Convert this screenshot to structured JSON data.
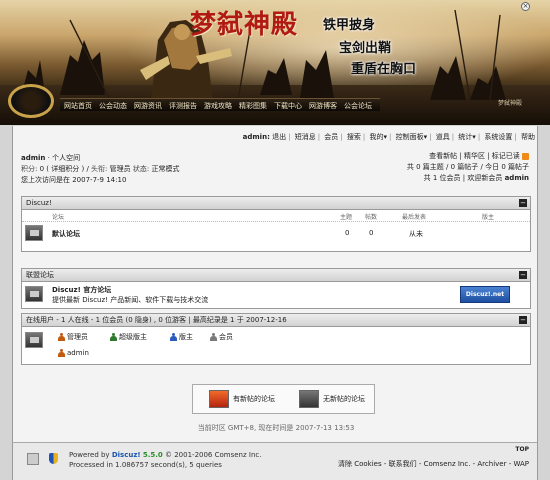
{
  "banner": {
    "title": "梦弑神殿",
    "slogan_lines": [
      "铁甲披身",
      "宝剑出鞘",
      "重盾在胸口"
    ],
    "nav": [
      "网站首页",
      "公会动态",
      "网游资讯",
      "评测报告",
      "游戏攻略",
      "精彩图集",
      "下载中心",
      "网游博客",
      "公会论坛"
    ],
    "right_text": "梦弑神殿",
    "close_icon": "close-icon"
  },
  "menubar": {
    "user": "admin:",
    "items": [
      "退出",
      "短消息",
      "会员",
      "搜索",
      "我的",
      "控制面板",
      "道具",
      "统计",
      "系统设置",
      "帮助"
    ]
  },
  "user": {
    "name": "admin",
    "space_link": "· 个人空间",
    "points_line_label": "积分:",
    "points_value": "0",
    "points_detail": "( 详细积分 )",
    "title_label": "头衔:",
    "title_value": "管理员",
    "status_label": "状态:",
    "status_value": "正常模式",
    "last_visit": "您上次访问是在 2007-7-9 14:10"
  },
  "stats": {
    "links": [
      "查看新帖",
      "精华区",
      "标记已读"
    ],
    "line2": "共 0 篇主题 / 0 篇帖子 / 今日 0 篇帖子",
    "line3_prefix": "共 1 位会员 | 欢迎新会员",
    "new_member": "admin"
  },
  "forum_category": {
    "title": "Discuz!",
    "columns": [
      "论坛",
      "主题",
      "帖数",
      "最后发表",
      "版主"
    ],
    "rows": [
      {
        "name": "默认论坛",
        "threads": "0",
        "posts": "0",
        "last_post": "从未",
        "moderators": ""
      }
    ]
  },
  "links_panel": {
    "title": "联盟论坛",
    "item_name": "Discuz! 官方论坛",
    "item_desc": "提供最新 Discuz! 产品新闻、软件下载与技术交流",
    "logo_text": "Discuz!.net"
  },
  "online": {
    "header": "在线用户 - 1 人在线 - 1 位会员 (0 隐身) , 0 位游客 | 最高纪录是 1 于 2007-12-16",
    "legend": [
      {
        "label": "管理员",
        "color": "#c25a10"
      },
      {
        "label": "超级版主",
        "color": "#2c7a2c"
      },
      {
        "label": "版主",
        "color": "#2a5cc0"
      },
      {
        "label": "会员",
        "color": "#7a7a7a"
      }
    ],
    "users": [
      "admin"
    ]
  },
  "legend_buttons": {
    "new": "有新帖的论坛",
    "no_new": "无新帖的论坛"
  },
  "time_line": "当前时区 GMT+8, 现在时间是 2007-7-13 13:53",
  "footer": {
    "top": "TOP",
    "powered_prefix": "Powered by",
    "brand": "Discuz!",
    "version": "5.5.0",
    "copyright": "© 2001-2006 Comsenz Inc.",
    "processed": "Processed in 1.086757 second(s), 5 queries",
    "links": "清除 Cookies - 联系我们 - Comsenz Inc. - Archiver - WAP"
  }
}
